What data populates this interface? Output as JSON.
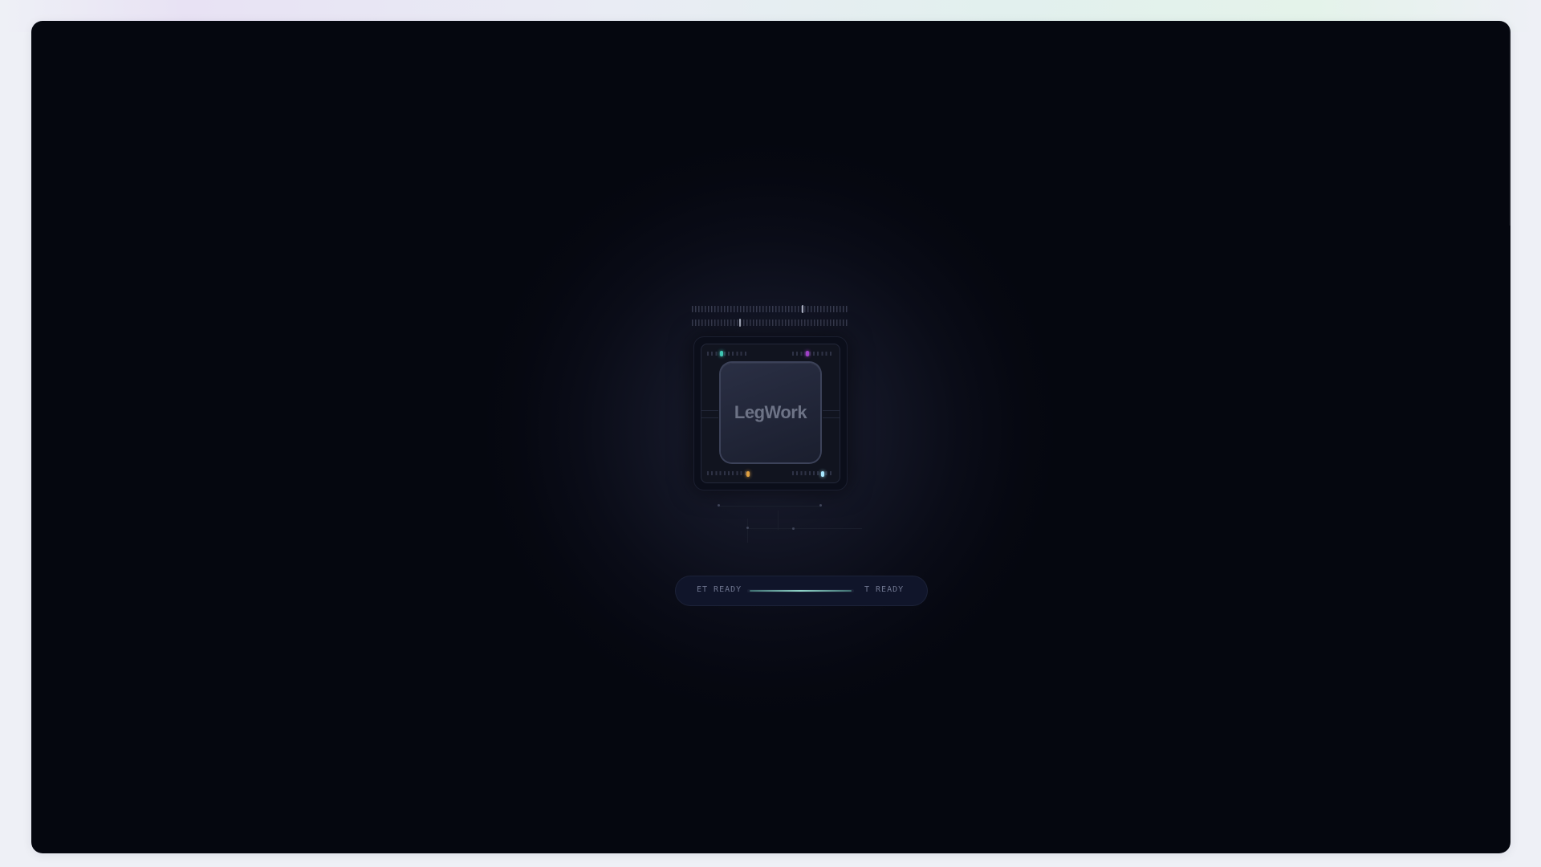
{
  "app": {
    "logo_text": "LegWork"
  },
  "status": {
    "left_text": "ET READY",
    "right_text": "T READY",
    "progress": 0.95
  },
  "leds": {
    "top_left": "#3fc6b4",
    "top_right": "#a040c8",
    "bottom_left": "#e0a040",
    "bottom_right": "#a8e8ff"
  },
  "colors": {
    "background": "#05070f",
    "accent": "#8fd4c8"
  }
}
